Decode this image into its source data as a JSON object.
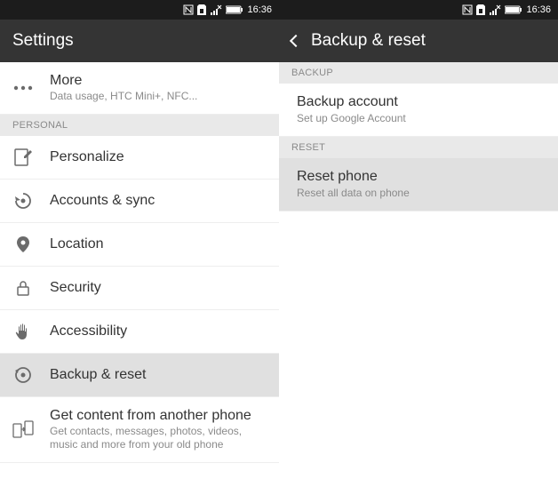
{
  "status": {
    "time": "16:36"
  },
  "left": {
    "title": "Settings",
    "more": {
      "label": "More",
      "sub": "Data usage, HTC Mini+, NFC..."
    },
    "personal_header": "PERSONAL",
    "personalize": {
      "label": "Personalize"
    },
    "accounts": {
      "label": "Accounts & sync"
    },
    "location": {
      "label": "Location"
    },
    "security": {
      "label": "Security"
    },
    "accessibility": {
      "label": "Accessibility"
    },
    "backup": {
      "label": "Backup & reset"
    },
    "getcontent": {
      "label": "Get content from another phone",
      "sub": "Get contacts, messages, photos, videos, music and more from your old phone"
    }
  },
  "right": {
    "title": "Backup & reset",
    "backup_header": "BACKUP",
    "backup_account": {
      "label": "Backup account",
      "sub": "Set up Google Account"
    },
    "reset_header": "RESET",
    "reset_phone": {
      "label": "Reset phone",
      "sub": "Reset all data on phone"
    }
  }
}
